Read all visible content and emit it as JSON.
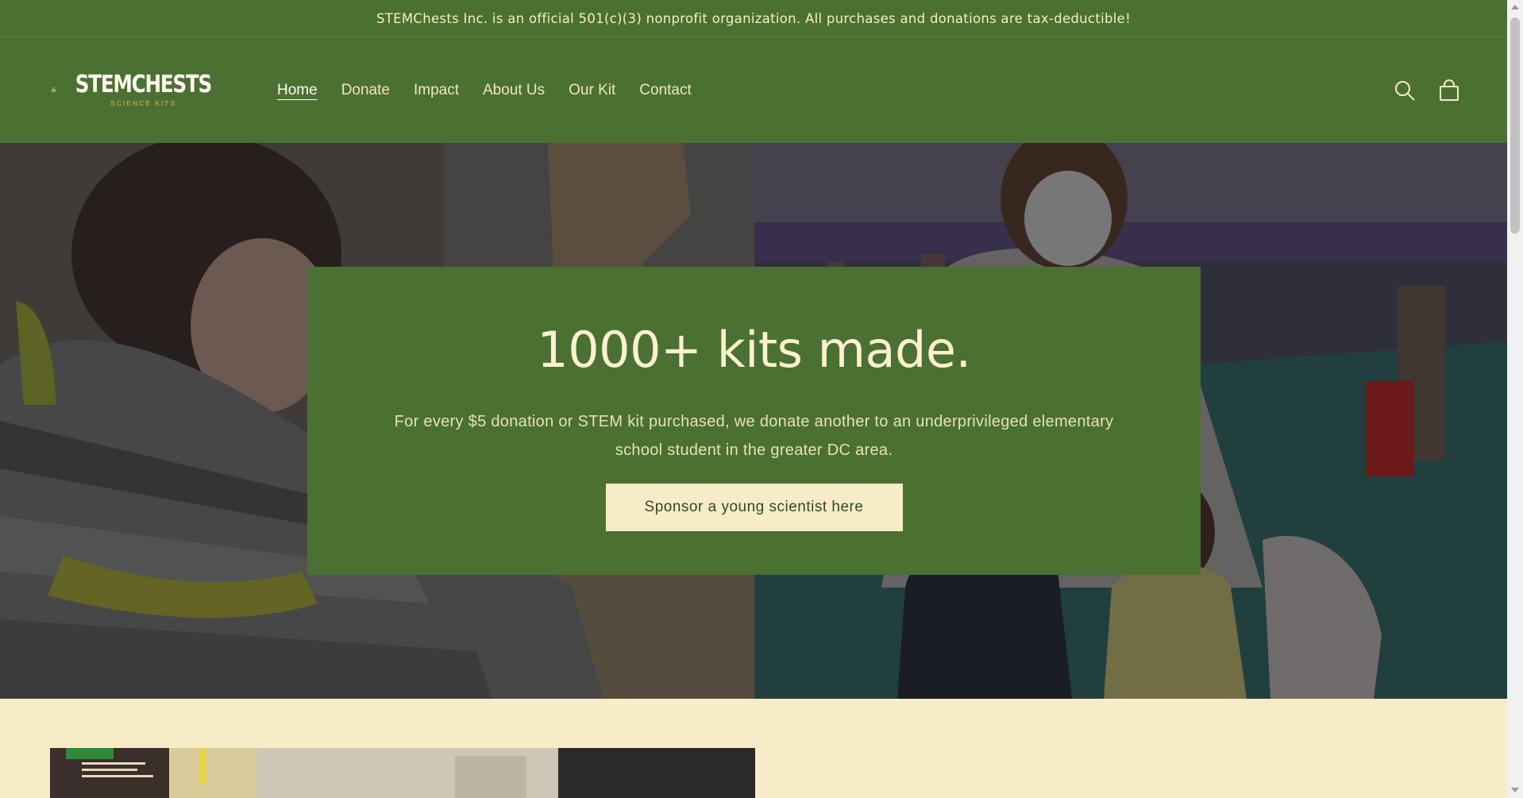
{
  "announcement": {
    "text": "STEMChests Inc. is an official 501(c)(3) nonprofit organization. All purchases and donations are tax-deductible!"
  },
  "header": {
    "logo": {
      "wordmark": "STEMCHESTS",
      "tagline": "SCIENCE KITS",
      "icon": "treasure-chest-sprout-icon"
    },
    "nav": [
      {
        "label": "Home",
        "active": true
      },
      {
        "label": "Donate",
        "active": false
      },
      {
        "label": "Impact",
        "active": false
      },
      {
        "label": "About Us",
        "active": false
      },
      {
        "label": "Our Kit",
        "active": false
      },
      {
        "label": "Contact",
        "active": false
      }
    ],
    "icons": [
      "search-icon",
      "cart-icon"
    ]
  },
  "hero": {
    "title": "1000+ kits made.",
    "text": "For every $5 donation or STEM kit purchased, we donate another to an underprivileged elementary school student in the greater DC area.",
    "button_label": "Sponsor a young scientist here",
    "images": [
      "child-with-cardboard-photo",
      "family-at-science-fair-photo"
    ]
  },
  "colors": {
    "brand_green": "#4a7132",
    "cream": "#f8ebc8",
    "logo_gold": "#e0b54a"
  }
}
